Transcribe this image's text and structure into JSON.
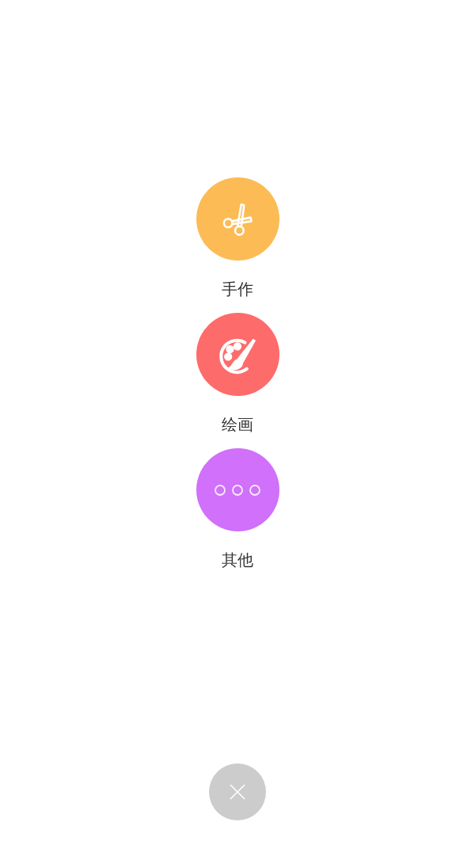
{
  "categories": [
    {
      "kind": "scissors",
      "label": "手作",
      "color": "#fdbb55"
    },
    {
      "kind": "palette",
      "label": "绘画",
      "color": "#fe6b6b"
    },
    {
      "kind": "more",
      "label": "其他",
      "color": "#d070fb"
    }
  ],
  "close_button": {
    "kind": "close"
  }
}
